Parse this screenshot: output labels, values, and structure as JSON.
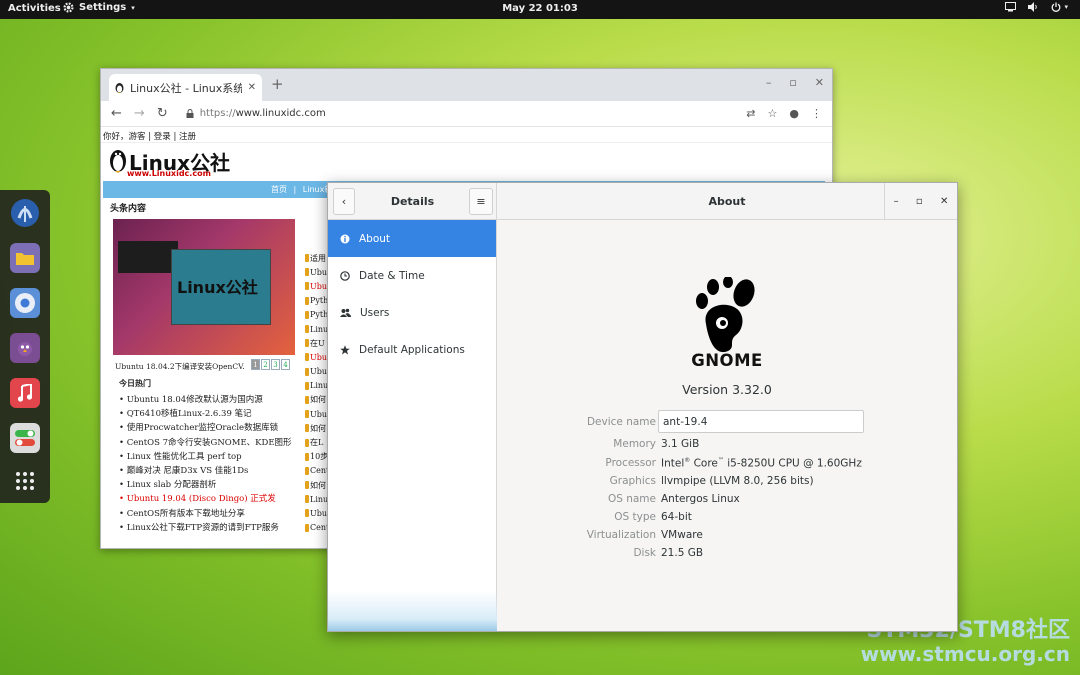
{
  "topbar": {
    "activities": "Activities",
    "app_menu": "Settings",
    "clock": "May 22  01:03"
  },
  "watermark": {
    "line1": "STM32/STM8社区",
    "line2": "www.stmcu.org.cn"
  },
  "browser": {
    "tab_title": "Linux公社 - Linux系统门",
    "url_scheme": "https://",
    "url_host": "www.linuxidc.com",
    "login_bar": "你好，游客  |  登录  |  注册",
    "logo_text": "Linux公社",
    "logo_url": "www.Linuxidc.com",
    "nav_items": [
      "首页",
      "|",
      "Linux新闻"
    ],
    "section_title": "头条内容",
    "feature_caption": "Ubuntu 18.04.2下编译安装OpenCV...",
    "feature_logo": "Linux公社",
    "pager": [
      "1",
      "2",
      "3",
      "4"
    ],
    "hot_title": "今日热门",
    "hot_items": [
      "Ubuntu 18.04修改默认源为国内源",
      "QT6410移植Linux-2.6.39 笔记",
      "使用Procwatcher监控Oracle数据库锁",
      "CentOS 7命令行安装GNOME、KDE图形",
      "Linux 性能优化工具 perf top",
      "巅峰对决 尼康D3x VS 佳能1Ds",
      "Linux slab 分配器剖析",
      "Ubuntu 19.04 (Disco Dingo) 正式发",
      "CentOS所有版本下载地址分享",
      "Linux公社下载FTP资源的请到FTP服务"
    ],
    "right_items": [
      "适用",
      "Ubu",
      "Ubu",
      "Pyth",
      "Pyth",
      "Linu",
      "在U",
      "Ubu",
      "Ubu",
      "Linu",
      "如何",
      "Ubu",
      "如何",
      "在L",
      "10步",
      "Cent",
      "如何",
      "Linu",
      "Ubu",
      "Cent"
    ]
  },
  "settings": {
    "left_title": "Details",
    "right_title": "About",
    "sidebar": [
      {
        "label": "About",
        "icon": "info-icon"
      },
      {
        "label": "Date & Time",
        "icon": "clock-icon"
      },
      {
        "label": "Users",
        "icon": "users-icon"
      },
      {
        "label": "Default Applications",
        "icon": "star-icon"
      }
    ],
    "about": {
      "logo_word": "GNOME",
      "version": "Version 3.32.0",
      "device_name_label": "Device name",
      "device_name_value": "ant-19.4",
      "memory_label": "Memory",
      "memory_value": "3.1 GiB",
      "processor_label": "Processor",
      "processor_intel": "Intel",
      "processor_core": "Core",
      "processor_rest": "i5-8250U CPU @ 1.60GHz",
      "graphics_label": "Graphics",
      "graphics_value": "llvmpipe (LLVM 8.0, 256 bits)",
      "osname_label": "OS name",
      "osname_value": "Antergos Linux",
      "ostype_label": "OS type",
      "ostype_value": "64-bit",
      "virt_label": "Virtualization",
      "virt_value": "VMware",
      "disk_label": "Disk",
      "disk_value": "21.5 GB"
    }
  },
  "colors": {
    "accent": "#3584e4",
    "topbar": "#141414",
    "browser_nav": "#6bb7e6"
  }
}
